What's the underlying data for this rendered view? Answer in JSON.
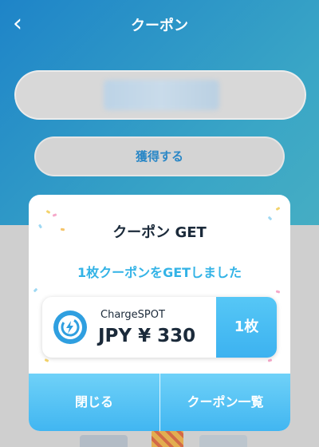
{
  "header": {
    "back_icon": "chevron-left-icon",
    "back_glyph": "‹",
    "title": "クーポン"
  },
  "background": {
    "code_input_value": "",
    "get_button_label": "獲得する"
  },
  "modal": {
    "title": "クーポン GET",
    "subtitle": "1枚クーポンをGETしました",
    "coupon": {
      "logo_icon": "chargespot-bolt-icon",
      "brand": "ChargeSPOT",
      "amount": "JPY ¥ 330",
      "count": "1枚"
    },
    "close_label": "閉じる",
    "list_label": "クーポン一覧"
  },
  "colors": {
    "accent": "#33b3e6",
    "button_gradient_top": "#6fd1f8",
    "button_gradient_bottom": "#41b6f1",
    "text_dark": "#1b2a3a"
  }
}
